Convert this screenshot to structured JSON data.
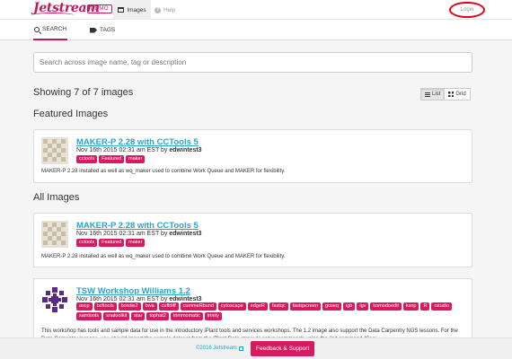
{
  "header": {
    "logo": "Jetstream",
    "badge": "DEMO",
    "nav": [
      {
        "label": "Images",
        "icon": "images-icon",
        "active": true
      },
      {
        "label": "Help",
        "icon": "help-icon",
        "active": false
      }
    ],
    "login_label": "Login"
  },
  "subnav": {
    "tabs": [
      {
        "label": "SEARCH",
        "icon": "search-icon",
        "active": true
      },
      {
        "label": "TAGS",
        "icon": "tags-icon",
        "active": false
      }
    ]
  },
  "search": {
    "placeholder": "Search across image name, tag or description",
    "value": ""
  },
  "results": {
    "summary": "Showing 7 of 7 images",
    "view_options": [
      {
        "label": "List",
        "icon": "list-icon",
        "active": true
      },
      {
        "label": "Grid",
        "icon": "grid-icon",
        "active": false
      }
    ]
  },
  "featured": {
    "title": "Featured Images",
    "items": [
      {
        "name": "MAKER-P 2.28 with CCTools 5",
        "date": "Nov 16th 2015 02:31 am EST by",
        "author": "edwintest3",
        "tags": [
          "cctools",
          "Featured",
          "maker"
        ],
        "description": "MAKER-P 2.28 installed as well as wq_maker used to combine Work Queue and MAKER for flexibility."
      }
    ]
  },
  "all": {
    "title": "All Images",
    "items": [
      {
        "name": "MAKER-P 2.28 with CCTools 5",
        "date": "Nov 16th 2015 02:31 am EST by",
        "author": "edwintest3",
        "tags": [
          "cctools",
          "Featured",
          "maker"
        ],
        "description": "MAKER-P 2.28 installed as well as wq_maker used to combine Work Queue and MAKER for flexibility."
      },
      {
        "name": "TSW Workshop Williams 1.2",
        "date": "Nov 16th 2015 02:31 am EST by",
        "author": "edwintest3",
        "tags": [
          "ascp",
          "bcftools",
          "bowtie2",
          "bwa",
          "cuffdiff",
          "cummeRbund",
          "cytoscape",
          "edgeR",
          "fastqc",
          "fastqscreen",
          "goseq",
          "igb",
          "igv",
          "komodoedit",
          "ksnp",
          "R",
          "rstudio",
          "samtools",
          "snatoolkit",
          "star",
          "tophat2",
          "trimmomatic",
          "trinity"
        ],
        "description": "This workshop has tools and sample data for use in the introductory iPlant tools and services workshops. The 1.2 image also support the Data Carpentry NGS lessons. For the Data Carpentry lessons, you should import the sample dataset from the iPlant Data store: 1) setup icommands using the iinit command (See:"
      }
    ]
  },
  "footer": {
    "copyright": "©2016 Jetstream",
    "feedback_label": "Feedback & Support"
  },
  "colors": {
    "brand": "#c2185b",
    "tag": "#d81b60",
    "link": "#29a3c9",
    "annotation": "#e0001b"
  }
}
